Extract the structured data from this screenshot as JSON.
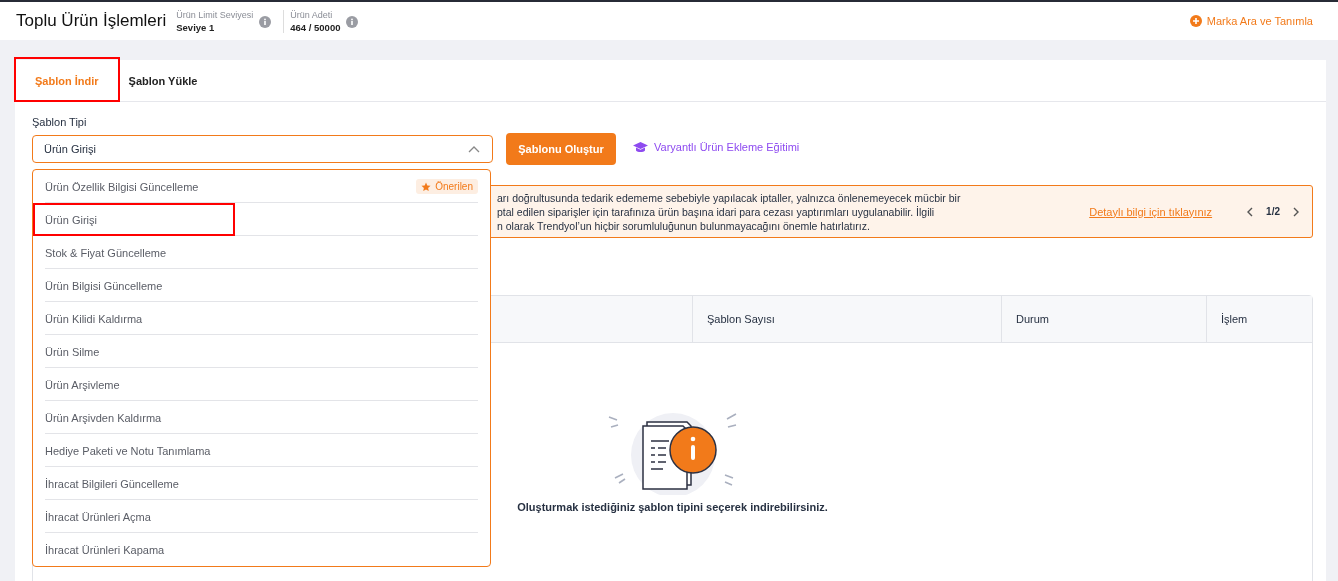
{
  "header": {
    "title": "Toplu Ürün İşlemleri",
    "stats": [
      {
        "label": "Ürün Limit Seviyesi",
        "value": "Seviye 1"
      },
      {
        "label": "Ürün Adeti",
        "value": "464 / 50000"
      }
    ],
    "action": "Marka Ara ve Tanımla"
  },
  "tabs": [
    {
      "label": "Şablon İndir",
      "selected": true,
      "annotated": true
    },
    {
      "label": "Şablon Yükle",
      "selected": false,
      "annotated": false
    }
  ],
  "form": {
    "label": "Şablon Tipi",
    "value": "Ürün Girişi",
    "expanded": true,
    "button": "Şablonu Oluştur",
    "link": "Varyantlı Ürün Ekleme Eğitimi"
  },
  "dropdown": [
    {
      "label": "Ürün Özellik Bilgisi Güncelleme",
      "badge": "Önerilen",
      "annotated": false
    },
    {
      "label": "Ürün Girişi",
      "annotated": true
    },
    {
      "label": "Stok & Fiyat Güncelleme",
      "annotated": false
    },
    {
      "label": "Ürün Bilgisi Güncelleme",
      "annotated": false
    },
    {
      "label": "Ürün Kilidi Kaldırma",
      "annotated": false
    },
    {
      "label": "Ürün Silme",
      "annotated": false
    },
    {
      "label": "Ürün Arşivleme",
      "annotated": false
    },
    {
      "label": "Ürün Arşivden Kaldırma",
      "annotated": false
    },
    {
      "label": "Hediye Paketi ve Notu Tanımlama",
      "annotated": false
    },
    {
      "label": "İhracat Bilgileri Güncelleme",
      "annotated": false
    },
    {
      "label": "İhracat Ürünleri Açma",
      "annotated": false
    },
    {
      "label": "İhracat Ürünleri Kapama",
      "annotated": false
    }
  ],
  "notice": {
    "lines": [
      "arı doğrultusunda tedarik edememe sebebiyle yapılacak iptaller, yalnızca önlenemeyecek mücbir bir",
      "ptal edilen siparişler için tarafınıza ürün başına idari para cezası yaptırımları uygulanabilir. İlgili",
      "n olarak Trendyol’un hiçbir sorumluluğunun bulunmayacağını önemle hatırlatırız."
    ],
    "link": "Detaylı bilgi için tıklayınız",
    "pager": "1/2"
  },
  "table": {
    "columns": [
      "Şablon Sayısı",
      "Durum",
      "İşlem"
    ],
    "empty_message": "Oluşturmak istediğiniz şablon tipini seçerek indirebilirsiniz."
  }
}
